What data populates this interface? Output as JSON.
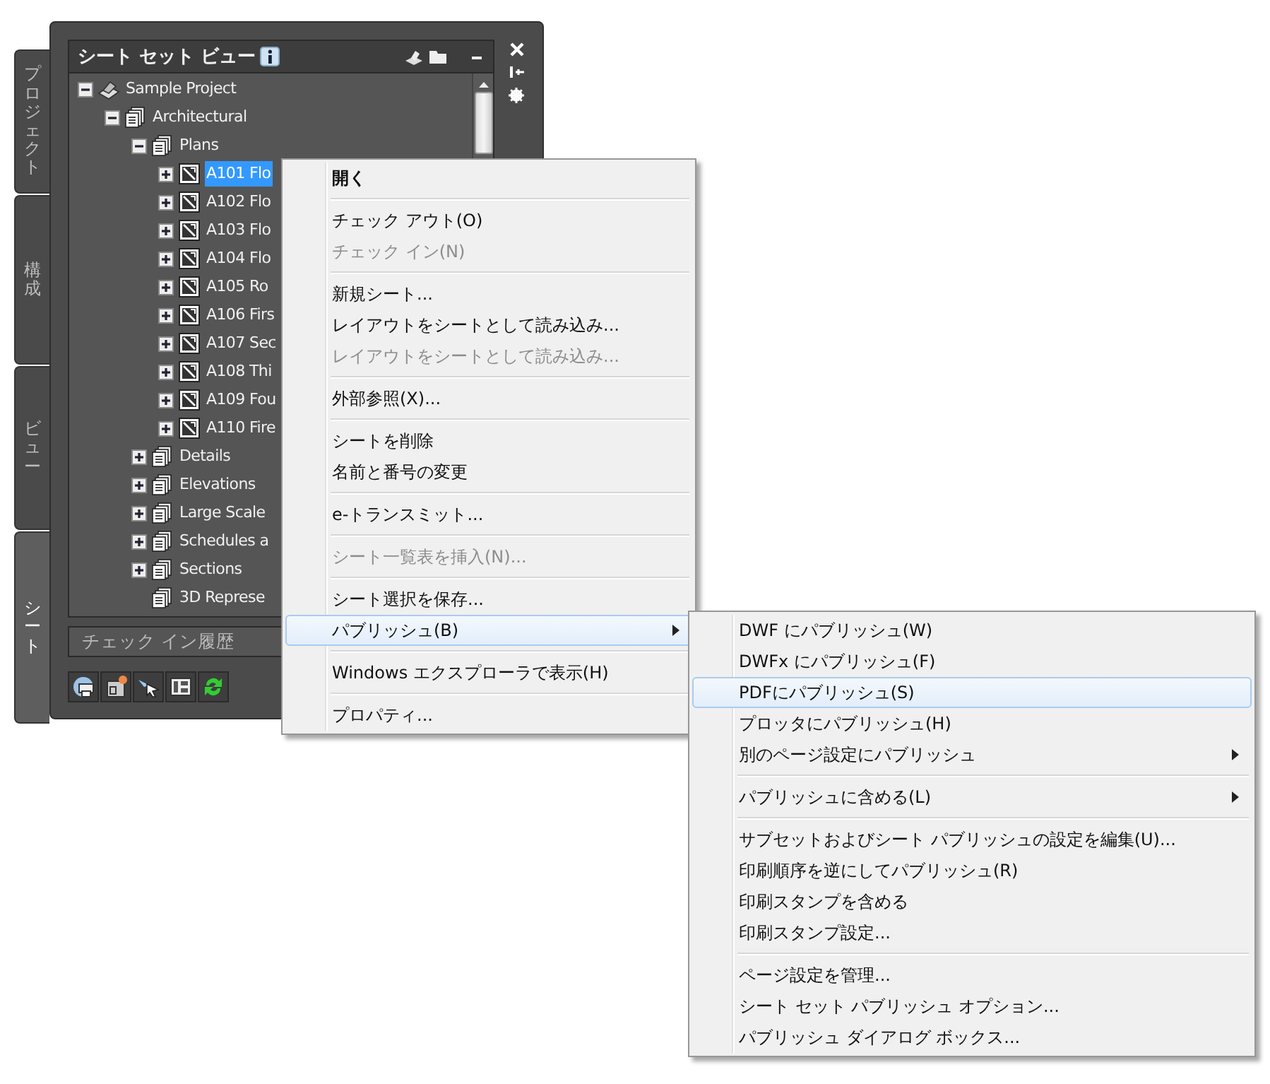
{
  "sheet_tabs": [
    {
      "label": "プロジェクト",
      "selected": false
    },
    {
      "label": "構成",
      "selected": false
    },
    {
      "label": "ビュー",
      "selected": false
    },
    {
      "label": "シート",
      "selected": true
    }
  ],
  "palette": {
    "title": "シート セット ビュー",
    "history_title": "チェック イン履歴"
  },
  "tree": [
    {
      "label": "Sample Project",
      "kind": "project",
      "expanded": true,
      "selected": false,
      "children": [
        {
          "label": "Architectural",
          "kind": "subset",
          "expanded": true,
          "selected": false,
          "children": [
            {
              "label": "Plans",
              "kind": "subset",
              "expanded": true,
              "selected": false,
              "children": [
                {
                  "label": "A101 Flo",
                  "kind": "sheet",
                  "expanded": false,
                  "selected": true
                },
                {
                  "label": "A102 Flo",
                  "kind": "sheet",
                  "expanded": false,
                  "selected": false
                },
                {
                  "label": "A103 Flo",
                  "kind": "sheet",
                  "expanded": false,
                  "selected": false
                },
                {
                  "label": "A104 Flo",
                  "kind": "sheet",
                  "expanded": false,
                  "selected": false
                },
                {
                  "label": "A105 Ro",
                  "kind": "sheet",
                  "expanded": false,
                  "selected": false
                },
                {
                  "label": "A106 Firs",
                  "kind": "sheet",
                  "expanded": false,
                  "selected": false
                },
                {
                  "label": "A107 Sec",
                  "kind": "sheet",
                  "expanded": false,
                  "selected": false
                },
                {
                  "label": "A108 Thi",
                  "kind": "sheet",
                  "expanded": false,
                  "selected": false
                },
                {
                  "label": "A109 Fou",
                  "kind": "sheet",
                  "expanded": false,
                  "selected": false
                },
                {
                  "label": "A110 Fire",
                  "kind": "sheet",
                  "expanded": false,
                  "selected": false
                }
              ]
            },
            {
              "label": "Details",
              "kind": "subset",
              "expanded": false,
              "selected": false
            },
            {
              "label": "Elevations",
              "kind": "subset",
              "expanded": false,
              "selected": false
            },
            {
              "label": "Large Scale",
              "kind": "subset",
              "expanded": false,
              "selected": false
            },
            {
              "label": "Schedules a",
              "kind": "subset",
              "expanded": false,
              "selected": false
            },
            {
              "label": "Sections",
              "kind": "subset",
              "expanded": false,
              "selected": false
            },
            {
              "label": "3D Represe",
              "kind": "subset",
              "selected": false
            }
          ]
        }
      ]
    }
  ],
  "context_menu": [
    {
      "kind": "item",
      "label": "開く",
      "default": true,
      "disabled": false,
      "selected": false,
      "submenu": false
    },
    {
      "kind": "separator"
    },
    {
      "kind": "item",
      "label": "チェック アウト(O)",
      "default": false,
      "disabled": false,
      "selected": false,
      "submenu": false
    },
    {
      "kind": "item",
      "label": "チェック イン(N)",
      "default": false,
      "disabled": true,
      "selected": false,
      "submenu": false
    },
    {
      "kind": "separator"
    },
    {
      "kind": "item",
      "label": "新規シート...",
      "default": false,
      "disabled": false,
      "selected": false,
      "submenu": false
    },
    {
      "kind": "item",
      "label": "レイアウトをシートとして読み込み...",
      "default": false,
      "disabled": false,
      "selected": false,
      "submenu": false
    },
    {
      "kind": "item",
      "label": "レイアウトをシートとして読み込み...",
      "default": false,
      "disabled": true,
      "selected": false,
      "submenu": false
    },
    {
      "kind": "separator"
    },
    {
      "kind": "item",
      "label": "外部参照(X)...",
      "default": false,
      "disabled": false,
      "selected": false,
      "submenu": false
    },
    {
      "kind": "separator"
    },
    {
      "kind": "item",
      "label": "シートを削除",
      "default": false,
      "disabled": false,
      "selected": false,
      "submenu": false
    },
    {
      "kind": "item",
      "label": "名前と番号の変更",
      "default": false,
      "disabled": false,
      "selected": false,
      "submenu": false
    },
    {
      "kind": "separator"
    },
    {
      "kind": "item",
      "label": "e-トランスミット...",
      "default": false,
      "disabled": false,
      "selected": false,
      "submenu": false
    },
    {
      "kind": "separator"
    },
    {
      "kind": "item",
      "label": "シート一覧表を挿入(N)...",
      "default": false,
      "disabled": true,
      "selected": false,
      "submenu": false
    },
    {
      "kind": "separator"
    },
    {
      "kind": "item",
      "label": "シート選択を保存...",
      "default": false,
      "disabled": false,
      "selected": false,
      "submenu": false
    },
    {
      "kind": "item",
      "label": "パブリッシュ(B)",
      "default": false,
      "disabled": false,
      "selected": true,
      "submenu": true
    },
    {
      "kind": "separator"
    },
    {
      "kind": "item",
      "label": "Windows エクスプローラで表示(H)",
      "default": false,
      "disabled": false,
      "selected": false,
      "submenu": false
    },
    {
      "kind": "separator"
    },
    {
      "kind": "item",
      "label": "プロパティ...",
      "default": false,
      "disabled": false,
      "selected": false,
      "submenu": false
    }
  ],
  "publish_submenu": [
    {
      "kind": "item",
      "label": "DWF にパブリッシュ(W)",
      "default": false,
      "disabled": false,
      "selected": false,
      "submenu": false
    },
    {
      "kind": "item",
      "label": "DWFx にパブリッシュ(F)",
      "default": false,
      "disabled": false,
      "selected": false,
      "submenu": false
    },
    {
      "kind": "item",
      "label": "PDFにパブリッシュ(S)",
      "default": false,
      "disabled": false,
      "selected": true,
      "submenu": false
    },
    {
      "kind": "item",
      "label": "プロッタにパブリッシュ(H)",
      "default": false,
      "disabled": false,
      "selected": false,
      "submenu": false
    },
    {
      "kind": "item",
      "label": "別のページ設定にパブリッシュ",
      "default": false,
      "disabled": false,
      "selected": false,
      "submenu": true
    },
    {
      "kind": "separator"
    },
    {
      "kind": "item",
      "label": "パブリッシュに含める(L)",
      "default": false,
      "disabled": false,
      "selected": false,
      "submenu": true
    },
    {
      "kind": "separator"
    },
    {
      "kind": "item",
      "label": "サブセットおよびシート パブリッシュの設定を編集(U)...",
      "default": false,
      "disabled": false,
      "selected": false,
      "submenu": false
    },
    {
      "kind": "item",
      "label": "印刷順序を逆にしてパブリッシュ(R)",
      "default": false,
      "disabled": false,
      "selected": false,
      "submenu": false
    },
    {
      "kind": "item",
      "label": "印刷スタンプを含める",
      "default": false,
      "disabled": false,
      "selected": false,
      "submenu": false
    },
    {
      "kind": "item",
      "label": "印刷スタンプ設定...",
      "default": false,
      "disabled": false,
      "selected": false,
      "submenu": false
    },
    {
      "kind": "separator"
    },
    {
      "kind": "item",
      "label": "ページ設定を管理...",
      "default": false,
      "disabled": false,
      "selected": false,
      "submenu": false
    },
    {
      "kind": "item",
      "label": "シート セット パブリッシュ オプション...",
      "default": false,
      "disabled": false,
      "selected": false,
      "submenu": false
    },
    {
      "kind": "item",
      "label": "パブリッシュ ダイアログ ボックス...",
      "default": false,
      "disabled": false,
      "selected": false,
      "submenu": false
    }
  ]
}
